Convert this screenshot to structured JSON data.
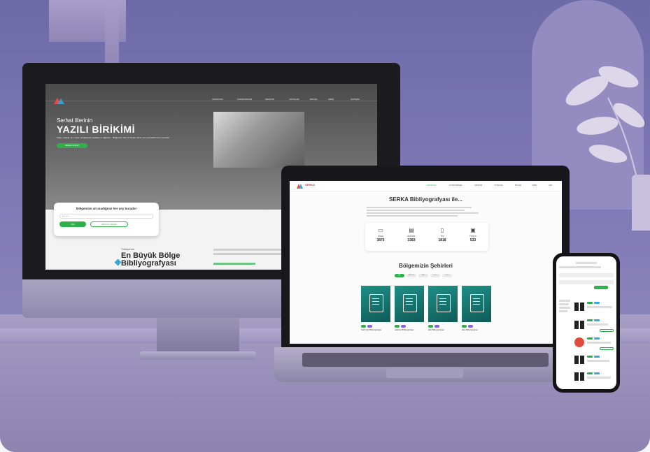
{
  "monitor": {
    "brand": "SERKA",
    "nav_items": [
      "ANASAYFA",
      "KATEGORİLER",
      "ARAŞTIR",
      "YAYINLAR",
      "BÖLGE",
      "GİRİŞ",
      "İLETİŞİM"
    ],
    "hero": {
      "kicker": "Serhat Illerinin",
      "title": "YAZILI BİRİKİMİ",
      "subtitle": "Kitap, makale, tez, rapor, ansiklopedi maddesi ve diğerleri... Bölgemize dair 10 binden fazla eser parmaklarınızın ucunda!",
      "button": "HEMEN KEŞFET"
    },
    "search": {
      "title": "Bölgemize ait aradığınız her şey burada!",
      "placeholder": "Eser ara...",
      "btn_primary": "ARA",
      "btn_secondary": "DETAYLI ARAMA"
    },
    "bottom": {
      "kicker": "Türkiye'nin",
      "line1": "En Büyük Bölge",
      "line2": "Bibliyografyası"
    }
  },
  "laptop": {
    "brand": "SERKA",
    "nav_items": [
      "ANASAYFA",
      "KATEGORİLER",
      "ARAŞTIR",
      "YAYINLAR",
      "BÖLGE",
      "GİRİŞ",
      "ARA"
    ],
    "heading": "SERKA Bibliyografyası ile...",
    "stats": [
      {
        "label": "Kitap",
        "value": "3876",
        "icon": "book-icon"
      },
      {
        "label": "Makale",
        "value": "3383",
        "icon": "newspaper-icon"
      },
      {
        "label": "Tez",
        "value": "1818",
        "icon": "document-icon"
      },
      {
        "label": "Rapor",
        "value": "533",
        "icon": "report-icon"
      }
    ],
    "cities_heading": "Bölgemizin Şehirleri",
    "cities": [
      "Ağrı",
      "Ardahan",
      "Iğdır",
      "Kars",
      "Van"
    ],
    "cards": [
      "Tarihi Ağrı Bibliyografyası",
      "Ardahan Bibliyografyası",
      "Iğdır Bibliyografyası",
      "Kars Bibliyografyası"
    ]
  },
  "colors": {
    "accent_green": "#2fb04a",
    "card_teal": "#1f8f88",
    "brand_red": "#d23b3b",
    "background_purple": "#7c76b4"
  }
}
